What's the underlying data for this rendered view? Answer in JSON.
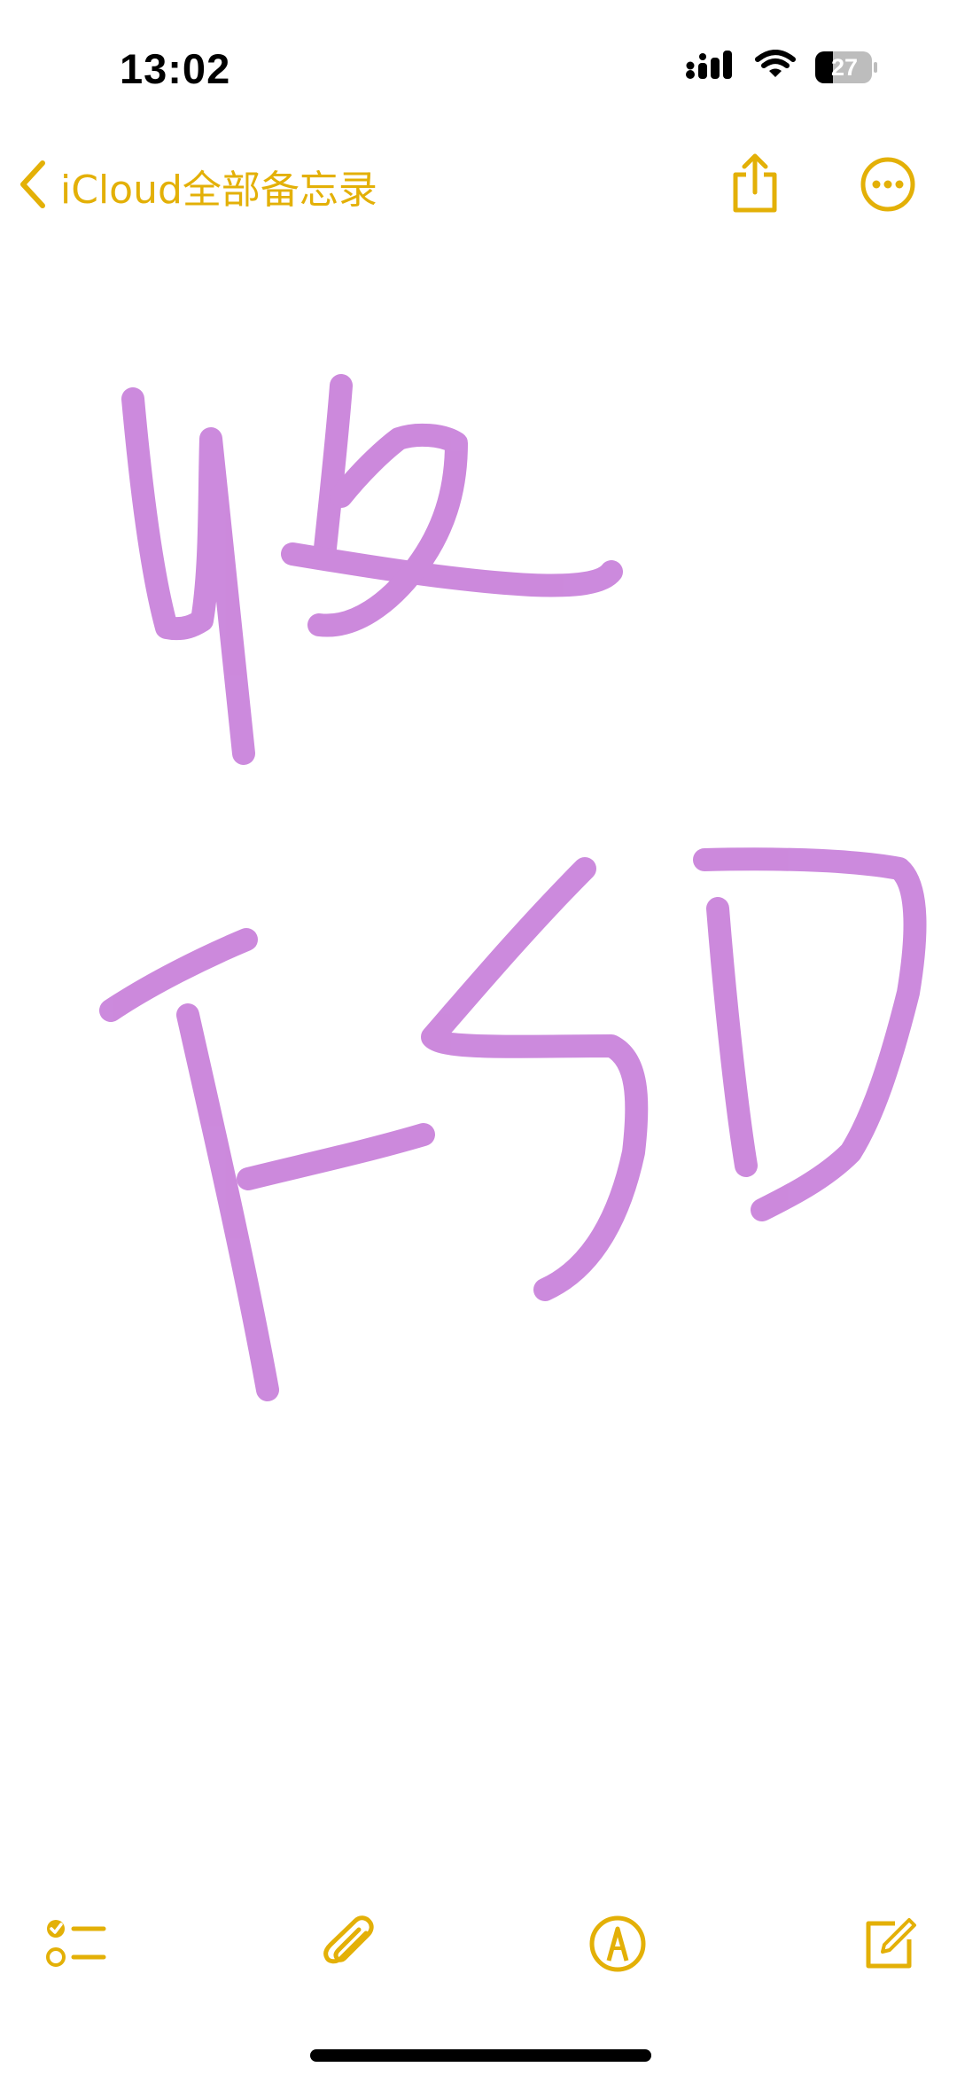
{
  "status_bar": {
    "time": "13:02",
    "battery": "27"
  },
  "nav": {
    "back_label": "iCloud全部备忘录",
    "share_icon": "share-icon",
    "more_icon": "ellipsis-circle-icon"
  },
  "note": {
    "drawing_strokes": [
      "handwritten-ink-stroke"
    ]
  },
  "toolbar": {
    "items": [
      "checklist-icon",
      "paperclip-icon",
      "markup-pen-icon",
      "compose-icon"
    ]
  },
  "colors": {
    "accent": "#E3B007",
    "ink": "#C77DD9",
    "background": "#FFFFFF"
  }
}
